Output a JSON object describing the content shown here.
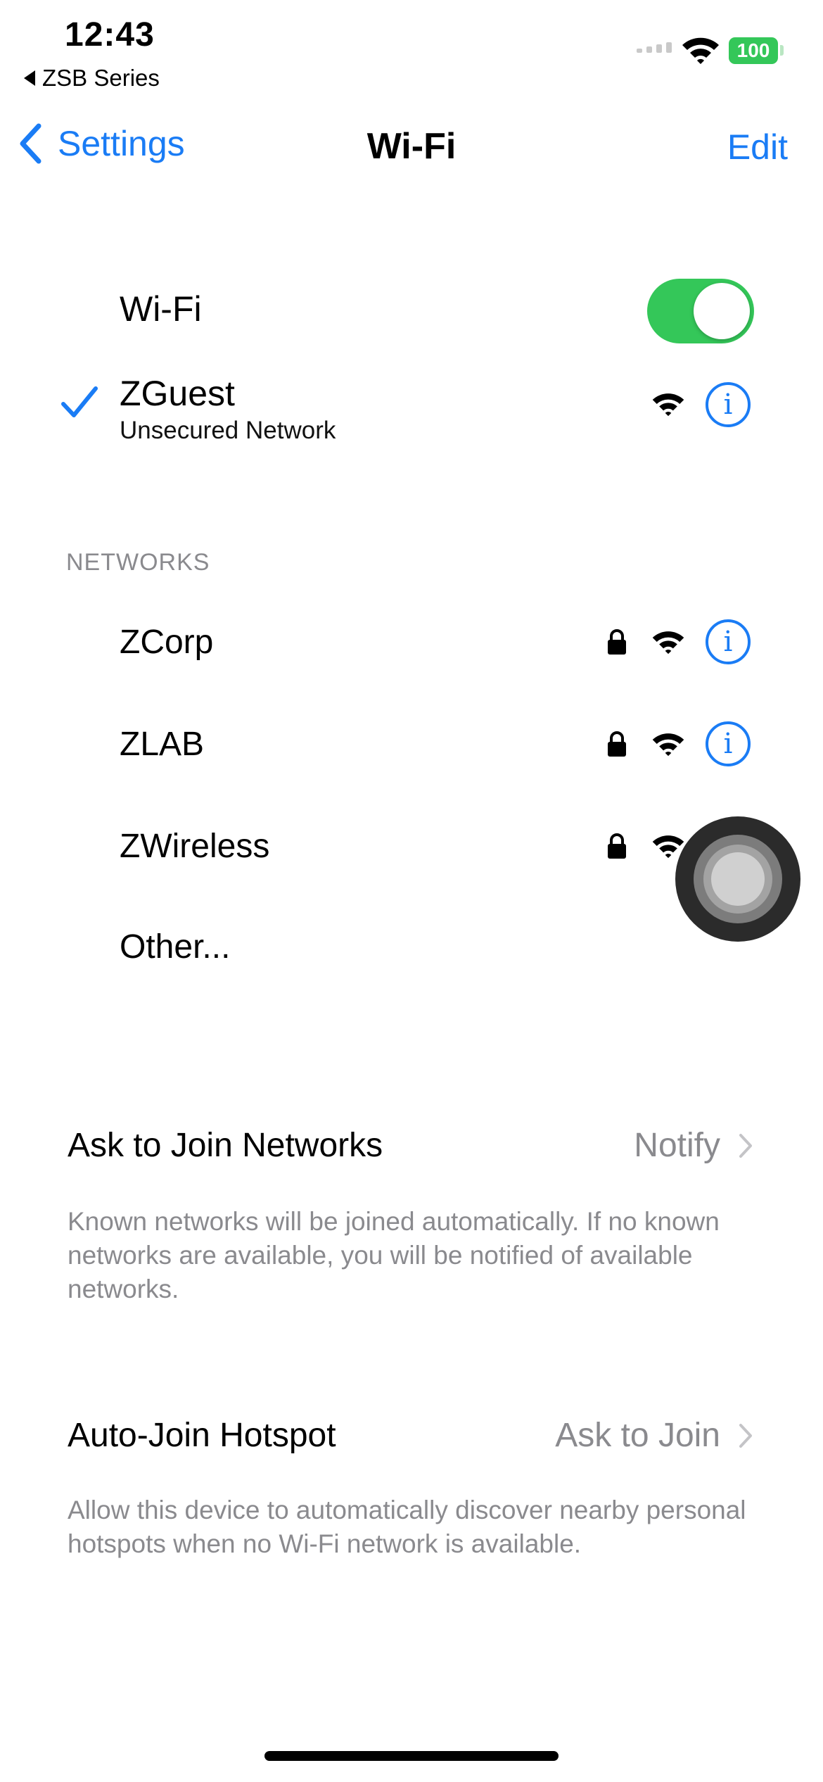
{
  "status_bar": {
    "time": "12:43",
    "back_app": "ZSB Series",
    "battery": "100"
  },
  "nav": {
    "back_label": "Settings",
    "title": "Wi-Fi",
    "edit_label": "Edit"
  },
  "wifi": {
    "label": "Wi-Fi",
    "enabled": true
  },
  "current_network": {
    "name": "ZGuest",
    "subtitle": "Unsecured Network"
  },
  "networks": {
    "header": "NETWORKS",
    "items": [
      {
        "name": "ZCorp",
        "locked": true
      },
      {
        "name": "ZLAB",
        "locked": true
      },
      {
        "name": "ZWireless",
        "locked": true
      }
    ],
    "other_label": "Other..."
  },
  "ask_to_join": {
    "label": "Ask to Join Networks",
    "value": "Notify",
    "description": "Known networks will be joined automatically. If no known networks are available, you will be notified of available networks."
  },
  "auto_join_hotspot": {
    "label": "Auto-Join Hotspot",
    "value": "Ask to Join",
    "description": "Allow this device to automatically discover nearby personal hotspots when no Wi-Fi network is available."
  },
  "colors": {
    "accent": "#1a7cf5",
    "toggle_on": "#34c759",
    "secondary_text": "#8a8a8e"
  },
  "icons": {
    "check": "checkmark-icon",
    "lock": "lock-icon",
    "signal": "wifi-signal-icon",
    "info": "info-icon",
    "chevron": "chevron-right-icon"
  }
}
